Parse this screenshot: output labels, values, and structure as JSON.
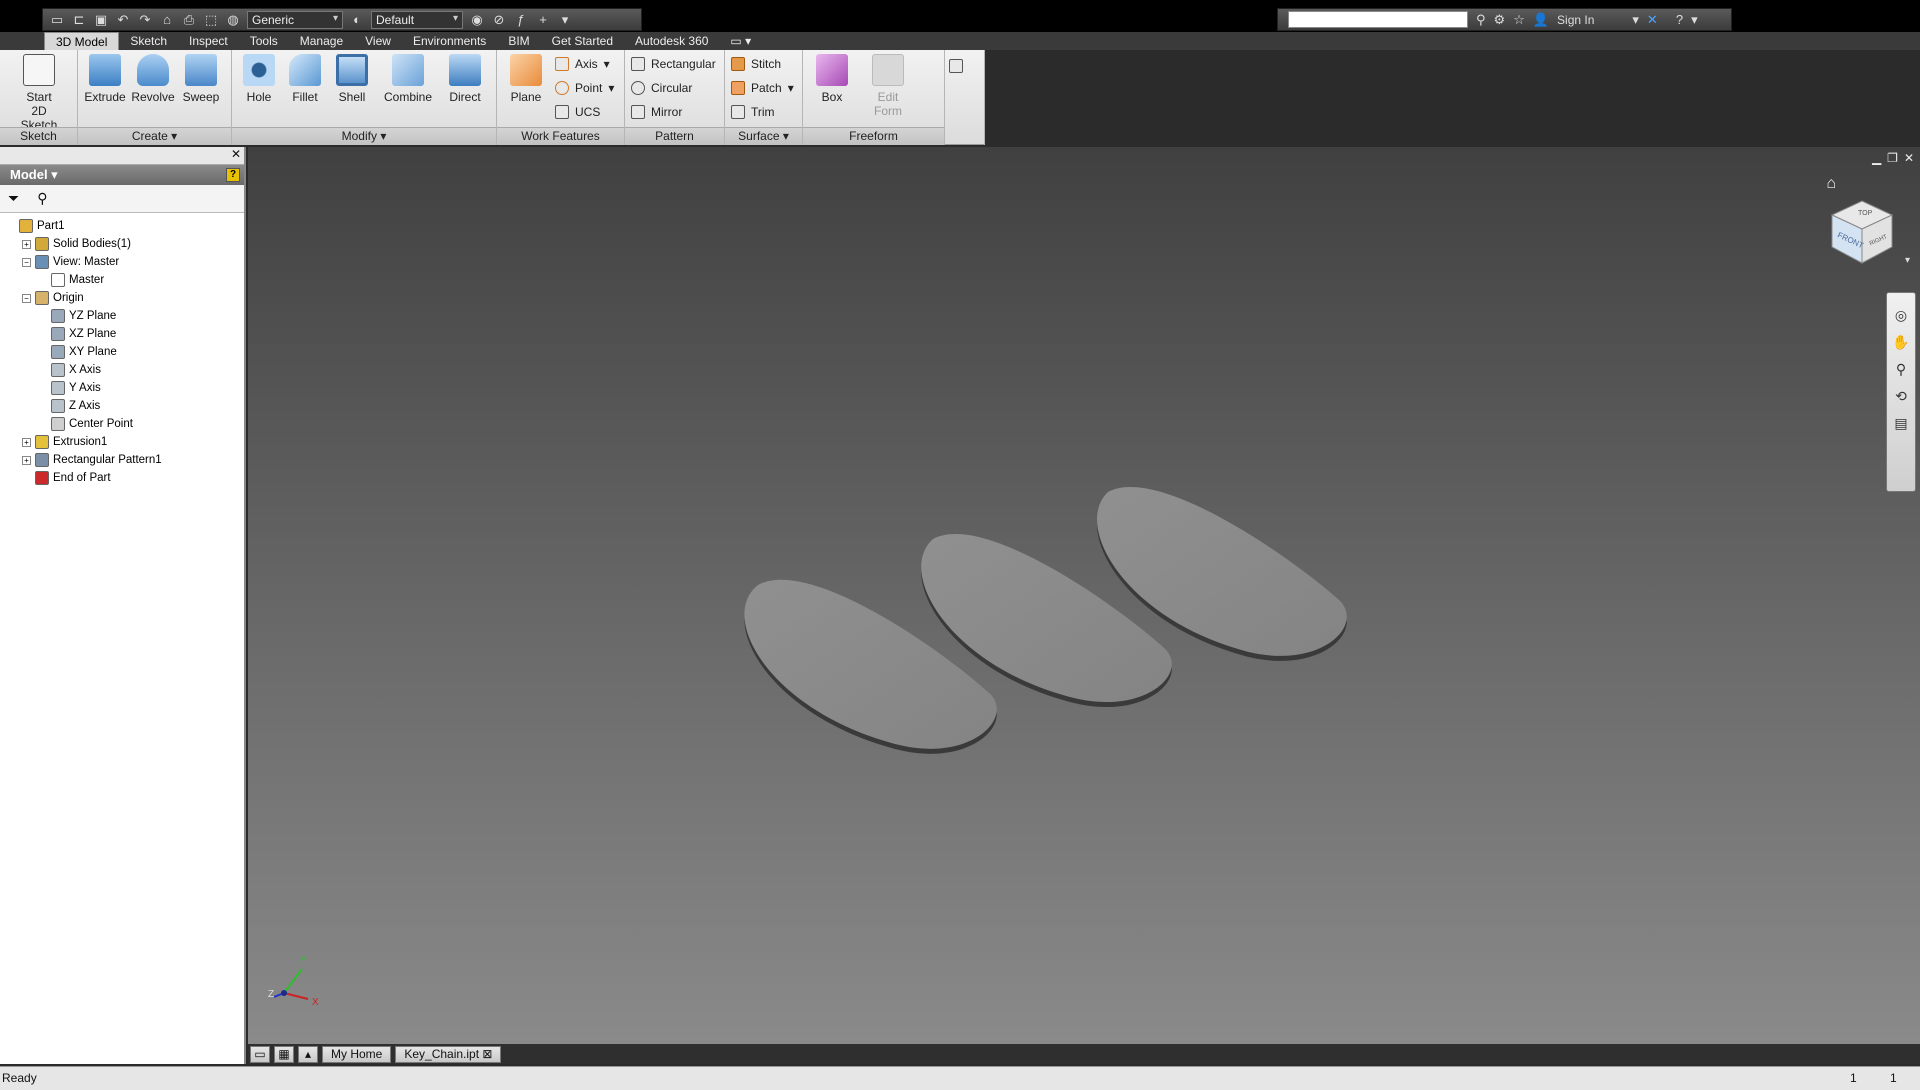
{
  "qat": {
    "appearance_select": "Generic",
    "material_select": "Default"
  },
  "search": {
    "sign_in": "Sign In",
    "help": "?"
  },
  "tabs": [
    "3D Model",
    "Sketch",
    "Inspect",
    "Tools",
    "Manage",
    "View",
    "Environments",
    "BIM",
    "Get Started",
    "Autodesk 360"
  ],
  "ribbon": {
    "sketch_panel": {
      "title": "Sketch",
      "start_sketch_l1": "Start",
      "start_sketch_l2": "2D Sketch"
    },
    "create_panel": {
      "title": "Create ▾",
      "extrude": "Extrude",
      "revolve": "Revolve",
      "sweep": "Sweep"
    },
    "modify_panel": {
      "title": "Modify ▾",
      "hole": "Hole",
      "fillet": "Fillet",
      "shell": "Shell",
      "combine": "Combine",
      "direct": "Direct"
    },
    "work_features_panel": {
      "title": "Work Features",
      "plane": "Plane",
      "axis": "Axis",
      "point": "Point",
      "ucs": "UCS"
    },
    "pattern_panel": {
      "title": "Pattern",
      "rectangular": "Rectangular",
      "circular": "Circular",
      "mirror": "Mirror"
    },
    "surface_panel": {
      "title": "Surface ▾",
      "stitch": "Stitch",
      "patch": "Patch",
      "trim": "Trim"
    },
    "freeform_panel": {
      "title": "Freeform",
      "box": "Box",
      "edit_form_l1": "Edit",
      "edit_form_l2": "Form"
    }
  },
  "browser": {
    "header": "Model ▾",
    "tree": [
      {
        "label": "Part1",
        "indent": 0,
        "expander": ""
      },
      {
        "label": "Solid Bodies(1)",
        "indent": 1,
        "expander": "+"
      },
      {
        "label": "View: Master",
        "indent": 1,
        "expander": "−"
      },
      {
        "label": "Master",
        "indent": 2,
        "expander": ""
      },
      {
        "label": "Origin",
        "indent": 1,
        "expander": "−"
      },
      {
        "label": "YZ Plane",
        "indent": 2,
        "expander": ""
      },
      {
        "label": "XZ Plane",
        "indent": 2,
        "expander": ""
      },
      {
        "label": "XY Plane",
        "indent": 2,
        "expander": ""
      },
      {
        "label": "X Axis",
        "indent": 2,
        "expander": ""
      },
      {
        "label": "Y Axis",
        "indent": 2,
        "expander": ""
      },
      {
        "label": "Z Axis",
        "indent": 2,
        "expander": ""
      },
      {
        "label": "Center Point",
        "indent": 2,
        "expander": ""
      },
      {
        "label": "Extrusion1",
        "indent": 1,
        "expander": "+"
      },
      {
        "label": "Rectangular Pattern1",
        "indent": 1,
        "expander": "+"
      },
      {
        "label": "End of Part",
        "indent": 1,
        "expander": ""
      }
    ]
  },
  "viewcube": {
    "top": "TOP",
    "front": "FRONT",
    "right": "RIGHT"
  },
  "triad": {
    "x": "X",
    "y": "Y",
    "z": "Z"
  },
  "doc_tabs": {
    "home": "My Home",
    "file": "Key_Chain.ipt"
  },
  "status": {
    "text": "Ready",
    "count1": "1",
    "count2": "1"
  },
  "colors": {
    "accent_tab": "#d8d8d8",
    "body_gray": "#8c8c8c"
  }
}
